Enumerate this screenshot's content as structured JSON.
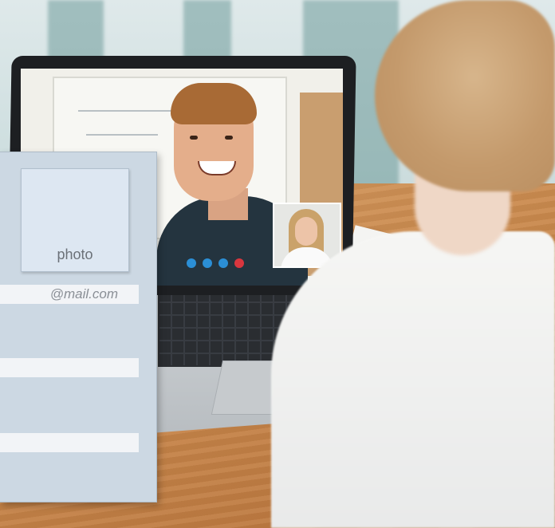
{
  "profile_form": {
    "photo_label": "photo",
    "email_field": {
      "value": "@mail.com",
      "placeholder": ""
    },
    "field_2": {
      "value": "",
      "placeholder": ""
    },
    "field_3": {
      "value": "",
      "placeholder": ""
    }
  },
  "video_call": {
    "controls": [
      {
        "name": "camera-icon",
        "color": "#2b8fd6"
      },
      {
        "name": "mic-icon",
        "color": "#2b8fd6"
      },
      {
        "name": "screen-share-icon",
        "color": "#2b8fd6"
      },
      {
        "name": "end-call-icon",
        "color": "#d9363e"
      }
    ]
  }
}
